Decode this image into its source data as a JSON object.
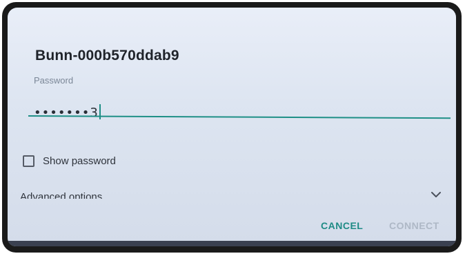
{
  "dialog": {
    "title": "Bunn-000b570ddab9",
    "password": {
      "label": "Password",
      "value": "•••••••3"
    },
    "show_password": {
      "label": "Show password",
      "checked": false
    },
    "advanced_options": {
      "label": "Advanced options",
      "icon": "chevron-down-icon"
    },
    "buttons": {
      "cancel": "CANCEL",
      "connect": "CONNECT"
    }
  },
  "colors": {
    "accent": "#1e8f86",
    "disabled": "#aeb8c6",
    "background": "#dde5f1"
  }
}
